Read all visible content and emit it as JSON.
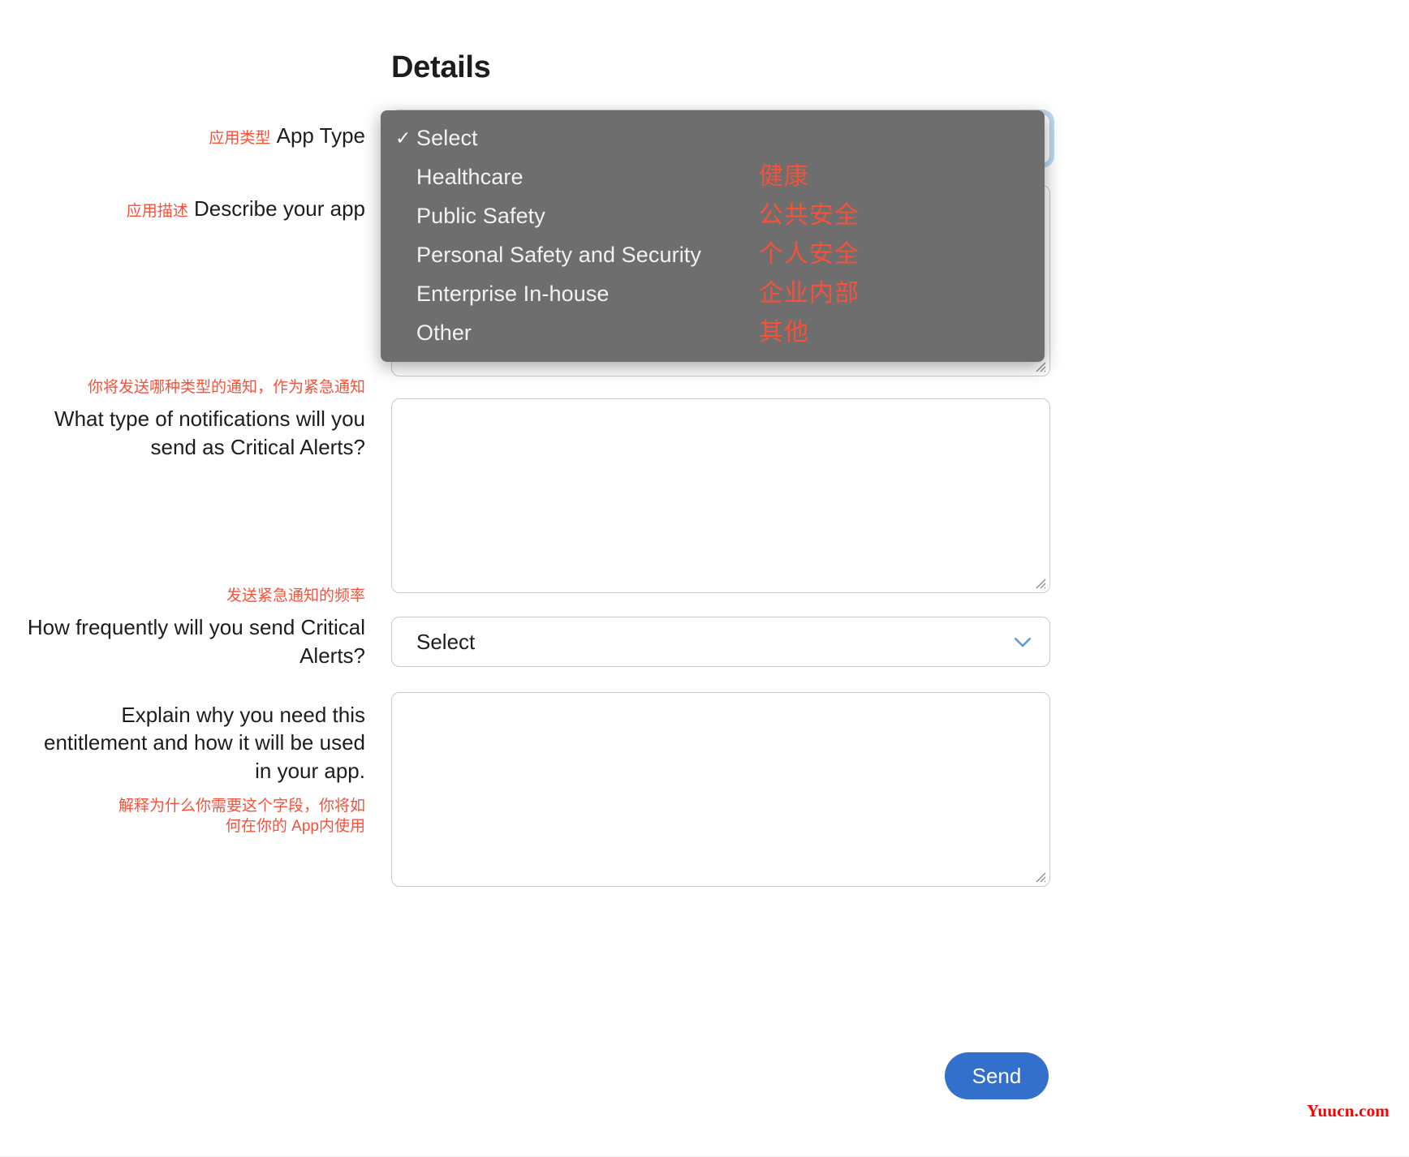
{
  "page": {
    "title": "Details",
    "watermark": "Yuucn.com"
  },
  "fields": {
    "app_type": {
      "label_cn": "应用类型",
      "label_en": "App Type",
      "value": "Select",
      "state": "focused-open"
    },
    "describe_app": {
      "label_cn": "应用描述",
      "label_en": "Describe your app",
      "value": ""
    },
    "notification_type": {
      "label_cn": "你将发送哪种类型的通知，作为紧急通知",
      "label_en": "What type of notifications will you send as Critical Alerts?",
      "value": ""
    },
    "frequency": {
      "label_cn": "发送紧急通知的频率",
      "label_en": "How frequently will you send Critical Alerts?",
      "value": "Select"
    },
    "explain": {
      "label_en": "Explain why you need this entitlement and how it will be used in your app.",
      "label_cn_line1": "解释为什么你需要这个字段，你将如",
      "label_cn_line2": "何在你的 App内使用",
      "value": ""
    }
  },
  "dropdown": {
    "open": true,
    "items": [
      {
        "label": "Select",
        "cn": "",
        "checked": true
      },
      {
        "label": "Healthcare",
        "cn": "健康",
        "checked": false
      },
      {
        "label": "Public Safety",
        "cn": "公共安全",
        "checked": false
      },
      {
        "label": "Personal Safety and Security",
        "cn": "个人安全",
        "checked": false
      },
      {
        "label": "Enterprise In-house",
        "cn": "企业内部",
        "checked": false
      },
      {
        "label": "Other",
        "cn": "其他",
        "checked": false
      }
    ],
    "check_glyph": "✓"
  },
  "actions": {
    "send_label": "Send"
  },
  "colors": {
    "annotation_red": "#f4523b",
    "accent_blue": "#3370cc",
    "popup_gray": "#6e6e6e",
    "watermark_red": "#fc0000",
    "chevron_blue": "#5b9bd5"
  }
}
